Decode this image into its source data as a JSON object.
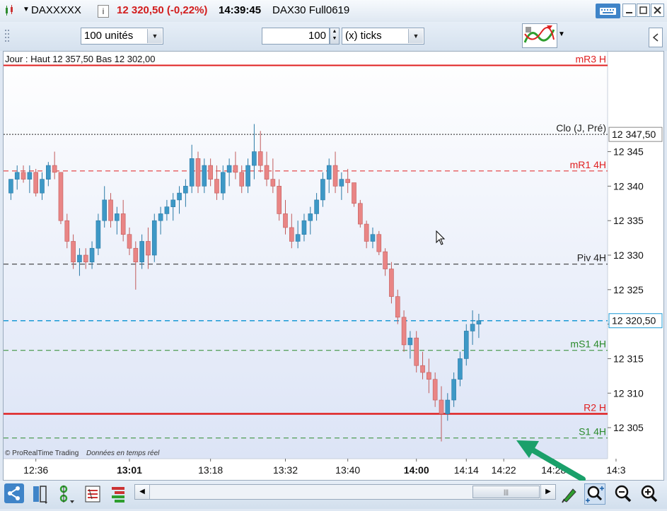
{
  "window": {
    "symbol": "DAXXXXX",
    "info_icon": "i",
    "price_change": "12 320,50 (-0,22%)",
    "time": "14:39:45",
    "instrument": "DAX30 Full0619"
  },
  "toolbar": {
    "units_value": "100 unités",
    "ticks_value": "100",
    "ticks_unit": "(x) ticks"
  },
  "chart": {
    "info_line": "Jour : Haut 12 357,50 Bas 12 302,00",
    "copyright": "© ProRealTime Trading",
    "realtime": "Données en temps réel",
    "last_price_label": "12 320,50",
    "close_prev_price": "12 347,50",
    "levels": [
      {
        "name": "mR3 H",
        "value": 12357.5,
        "color": "#e02020",
        "style": "solid",
        "width": 2
      },
      {
        "name": "Clo (J, Pré)",
        "value": 12347.5,
        "color": "#222222",
        "style": "dotted",
        "width": 1
      },
      {
        "name": "mR1 4H",
        "value": 12342.2,
        "color": "#e02020",
        "style": "dashed",
        "width": 1
      },
      {
        "name": "Piv 4H",
        "value": 12328.7,
        "color": "#222222",
        "style": "dashed",
        "width": 1
      },
      {
        "name": "",
        "value": 12320.5,
        "color": "#1a9ad6",
        "style": "dashed",
        "width": 1.5
      },
      {
        "name": "mS1 4H",
        "value": 12316.2,
        "color": "#2a8a2a",
        "style": "dashed",
        "width": 1
      },
      {
        "name": "R2 H",
        "value": 12307.0,
        "color": "#e02020",
        "style": "solid",
        "width": 2.5
      },
      {
        "name": "S1 4H",
        "value": 12303.5,
        "color": "#2a8a2a",
        "style": "dashed",
        "width": 1
      }
    ]
  },
  "chart_data": {
    "type": "candlestick",
    "y_ticks": [
      12305,
      12310,
      12315,
      12320,
      12325,
      12330,
      12335,
      12340,
      12345
    ],
    "y_tick_labels": [
      "12 305",
      "12 310",
      "12 315",
      "12 320",
      "12 325",
      "12 330",
      "12 335",
      "12 340",
      "12 345"
    ],
    "ylim": [
      12300.5,
      12359.5
    ],
    "x_labels": [
      {
        "label": "12:36",
        "bold": false,
        "bar": 4
      },
      {
        "label": "13:01",
        "bold": true,
        "bar": 19
      },
      {
        "label": "13:18",
        "bold": false,
        "bar": 32
      },
      {
        "label": "13:32",
        "bold": false,
        "bar": 44
      },
      {
        "label": "13:40",
        "bold": false,
        "bar": 54
      },
      {
        "label": "14:00",
        "bold": true,
        "bar": 65
      },
      {
        "label": "14:14",
        "bold": false,
        "bar": 73
      },
      {
        "label": "14:22",
        "bold": false,
        "bar": 79
      },
      {
        "label": "14:28",
        "bold": false,
        "bar": 87
      },
      {
        "label": "14:3",
        "bold": false,
        "bar": 97
      }
    ],
    "candles": [
      [
        12339,
        12341,
        12338,
        12341
      ],
      [
        12341,
        12343,
        12339.5,
        12342
      ],
      [
        12342,
        12343,
        12340.5,
        12341
      ],
      [
        12341,
        12343,
        12339,
        12342
      ],
      [
        12342,
        12342.5,
        12338.5,
        12339
      ],
      [
        12339,
        12342,
        12338,
        12341
      ],
      [
        12341,
        12343.5,
        12340,
        12343
      ],
      [
        12343,
        12345,
        12341,
        12342
      ],
      [
        12342,
        12341.5,
        12334.5,
        12335
      ],
      [
        12335,
        12336,
        12331,
        12332
      ],
      [
        12332,
        12333,
        12328,
        12329
      ],
      [
        12329,
        12331,
        12327,
        12330
      ],
      [
        12330,
        12331,
        12328,
        12329
      ],
      [
        12329,
        12332,
        12328,
        12331
      ],
      [
        12331,
        12336,
        12330,
        12335
      ],
      [
        12335,
        12340,
        12334,
        12338
      ],
      [
        12338,
        12339,
        12334,
        12335
      ],
      [
        12335,
        12337,
        12333,
        12336
      ],
      [
        12336,
        12338,
        12332,
        12333
      ],
      [
        12333,
        12334,
        12330,
        12331
      ],
      [
        12331,
        12332,
        12325,
        12329
      ],
      [
        12329,
        12333,
        12328,
        12332
      ],
      [
        12332,
        12334,
        12328,
        12330
      ],
      [
        12330,
        12336,
        12329,
        12335
      ],
      [
        12335,
        12337,
        12333,
        12336
      ],
      [
        12336,
        12338,
        12335,
        12337
      ],
      [
        12337,
        12339,
        12335,
        12338
      ],
      [
        12338,
        12340,
        12336,
        12339
      ],
      [
        12339,
        12341,
        12337,
        12340
      ],
      [
        12340,
        12346,
        12339,
        12344
      ],
      [
        12344,
        12345,
        12339,
        12340
      ],
      [
        12340,
        12344,
        12339,
        12343
      ],
      [
        12343,
        12344,
        12340,
        12341
      ],
      [
        12341,
        12343,
        12338,
        12339
      ],
      [
        12339,
        12343,
        12338,
        12342
      ],
      [
        12342,
        12344,
        12340,
        12343
      ],
      [
        12343,
        12345,
        12341,
        12342
      ],
      [
        12342,
        12343,
        12339,
        12340
      ],
      [
        12340,
        12344,
        12339,
        12343
      ],
      [
        12343,
        12349,
        12341,
        12345
      ],
      [
        12345,
        12348,
        12342,
        12343
      ],
      [
        12343,
        12345,
        12340,
        12341
      ],
      [
        12341,
        12344,
        12339,
        12340
      ],
      [
        12340,
        12341,
        12335,
        12336
      ],
      [
        12336,
        12338,
        12333,
        12334
      ],
      [
        12334,
        12336,
        12331,
        12332
      ],
      [
        12332,
        12335,
        12331,
        12333
      ],
      [
        12333,
        12336,
        12332,
        12335
      ],
      [
        12335,
        12337,
        12333,
        12336
      ],
      [
        12336,
        12339,
        12335,
        12338
      ],
      [
        12338,
        12342,
        12337,
        12341
      ],
      [
        12341,
        12344,
        12339,
        12343
      ],
      [
        12343,
        12345,
        12339,
        12340
      ],
      [
        12340,
        12342,
        12338,
        12341
      ],
      [
        12341,
        12342.5,
        12339,
        12340.5
      ],
      [
        12340.5,
        12340,
        12337,
        12337.5
      ],
      [
        12337.5,
        12338,
        12334,
        12334.5
      ],
      [
        12334.5,
        12335,
        12331,
        12332
      ],
      [
        12332,
        12334,
        12331,
        12333
      ],
      [
        12333,
        12333.5,
        12330,
        12330.5
      ],
      [
        12330.5,
        12331,
        12327,
        12328
      ],
      [
        12328,
        12329,
        12323,
        12324
      ],
      [
        12324,
        12325,
        12320,
        12321
      ],
      [
        12321,
        12322,
        12316,
        12317
      ],
      [
        12317,
        12319,
        12315,
        12318
      ],
      [
        12318,
        12319,
        12313,
        12314
      ],
      [
        12314,
        12316,
        12312,
        12313
      ],
      [
        12313,
        12315,
        12310,
        12312
      ],
      [
        12312,
        12313,
        12308,
        12309
      ],
      [
        12309,
        12311,
        12303,
        12307
      ],
      [
        12307,
        12310,
        12306,
        12309
      ],
      [
        12309,
        12313,
        12308,
        12312
      ],
      [
        12312,
        12316,
        12311,
        12315
      ],
      [
        12315,
        12320,
        12314,
        12319
      ],
      [
        12319,
        12322,
        12317,
        12320
      ],
      [
        12320,
        12321.5,
        12318,
        12320.5
      ]
    ]
  },
  "bottom": {
    "icons": [
      "share-icon",
      "layout-icon",
      "indicator-icon",
      "tools-icon",
      "orderbook-icon"
    ]
  }
}
